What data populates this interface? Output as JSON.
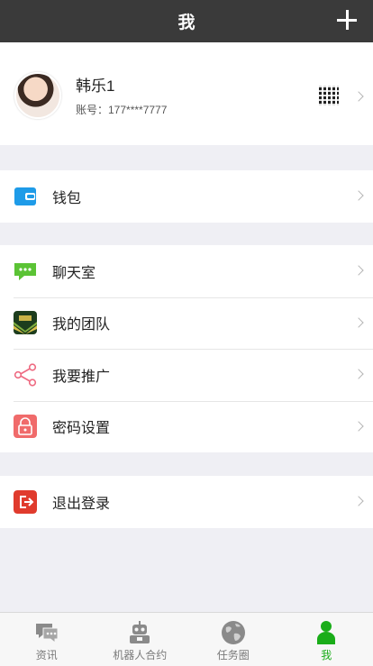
{
  "header": {
    "title": "我",
    "add_icon": "plus-icon"
  },
  "profile": {
    "name": "韩乐1",
    "account": "账号：177****7777",
    "qr_icon": "qr-code-icon"
  },
  "menu_groups": [
    [
      {
        "label": "钱包",
        "icon": "wallet-icon",
        "color": "#1e9be8"
      }
    ],
    [
      {
        "label": "聊天室",
        "icon": "chat-icon",
        "color": "#5bc335"
      },
      {
        "label": "我的团队",
        "icon": "team-icon",
        "color": "#2f5d2a"
      },
      {
        "label": "我要推广",
        "icon": "share-icon",
        "color": "#ee6b82"
      },
      {
        "label": "密码设置",
        "icon": "lock-icon",
        "color": "#f06b6b"
      }
    ],
    [
      {
        "label": "退出登录",
        "icon": "logout-icon",
        "color": "#e03b2d"
      }
    ]
  ],
  "tabs": [
    {
      "label": "资讯",
      "icon": "news-chat-icon"
    },
    {
      "label": "机器人合约",
      "icon": "robot-icon"
    },
    {
      "label": "任务圈",
      "icon": "globe-icon"
    },
    {
      "label": "我",
      "icon": "user-icon",
      "active": true
    }
  ],
  "colors": {
    "header_bg": "#3a3a3a",
    "active_tab": "#1aad19",
    "page_bg": "#efeff4"
  }
}
